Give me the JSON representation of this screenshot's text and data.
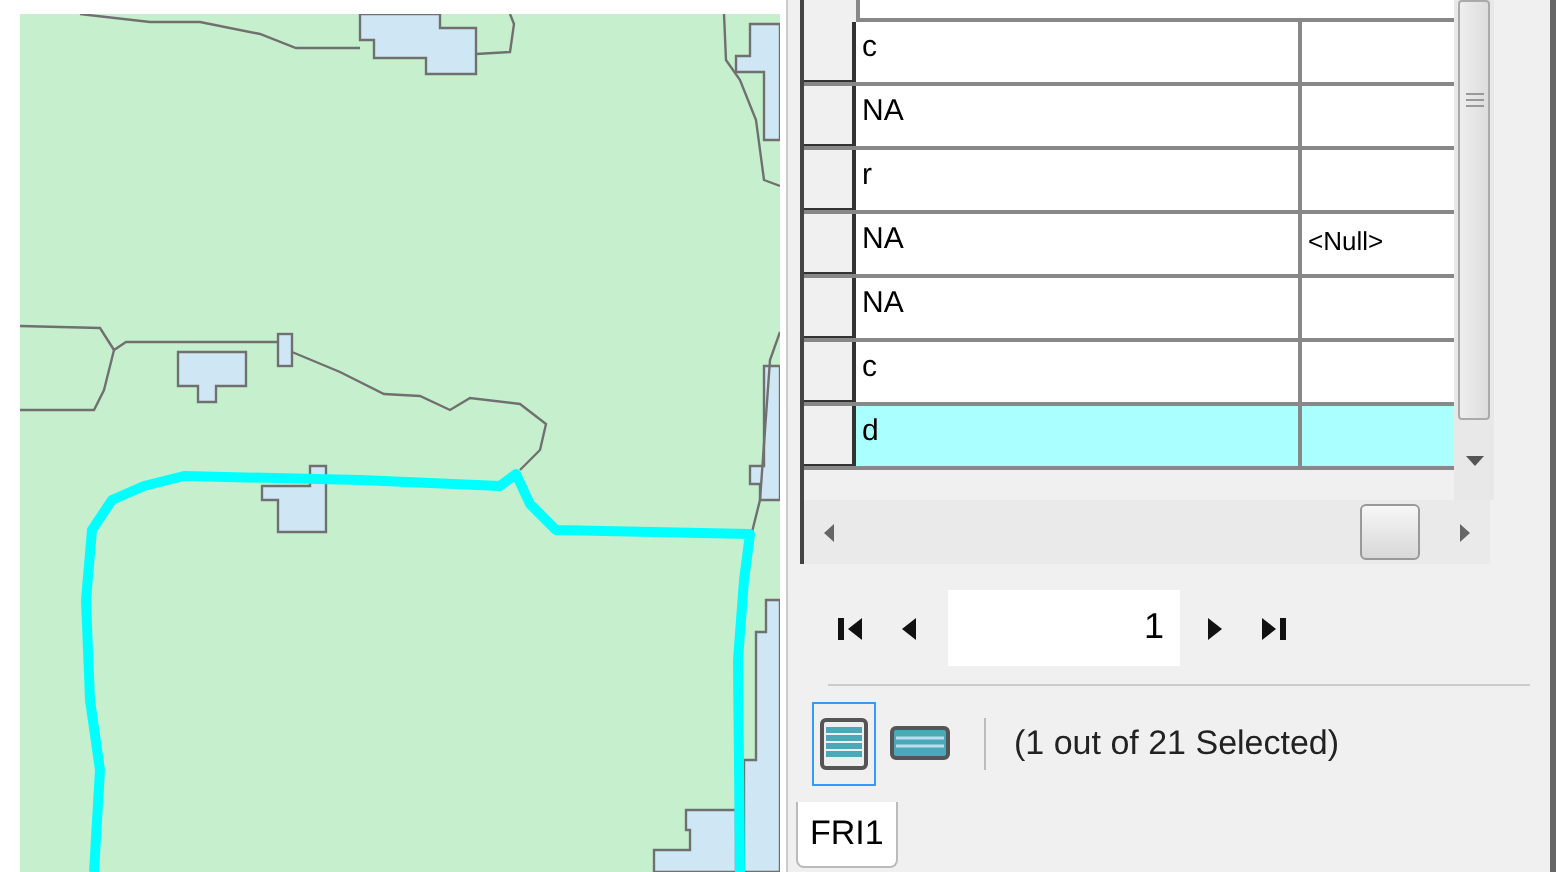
{
  "table": {
    "rows": [
      {
        "col_1": "c",
        "selected": false
      },
      {
        "col_1": "NA",
        "selected": false
      },
      {
        "col_1": "r",
        "selected": false
      },
      {
        "col_1": "NA",
        "col_2": "<Null>",
        "selected": false
      },
      {
        "col_1": "NA",
        "selected": false
      },
      {
        "col_1": "c",
        "selected": false
      },
      {
        "col_1": "d",
        "selected": true
      }
    ]
  },
  "record_navigator": {
    "current_record": "1"
  },
  "view_buttons": [
    {
      "selected": true
    },
    {
      "selected": false
    }
  ],
  "status": "(1 out of 21 Selected)",
  "tabs": [
    {
      "label": "FRI1",
      "selected": true
    }
  ]
}
